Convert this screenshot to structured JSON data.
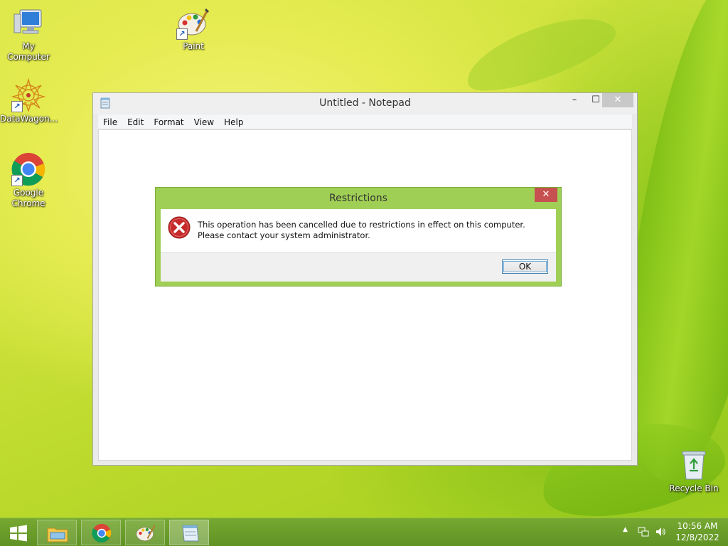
{
  "desktop": {
    "icons": [
      {
        "label": "My Computer",
        "icon": "computer-icon"
      },
      {
        "label": "Paint",
        "icon": "paint-palette-icon"
      },
      {
        "label": "DataWagon...",
        "icon": "datawagon-icon"
      },
      {
        "label": "Google Chrome",
        "icon": "chrome-icon"
      },
      {
        "label": "Recycle Bin",
        "icon": "recycle-bin-icon"
      }
    ]
  },
  "notepad": {
    "title": "Untitled - Notepad",
    "menu": [
      "File",
      "Edit",
      "Format",
      "View",
      "Help"
    ],
    "caption_buttons": {
      "minimize": "–",
      "maximize": "☐",
      "close": "✕"
    }
  },
  "dialog": {
    "title": "Restrictions",
    "message": "This operation has been cancelled due to restrictions in effect on this computer. Please contact your system administrator.",
    "ok_label": "OK",
    "close_glyph": "✕",
    "icon": "error-icon"
  },
  "taskbar": {
    "pinned": [
      "file-explorer-icon",
      "chrome-icon",
      "paint-palette-icon",
      "notepad-icon"
    ],
    "clock": {
      "time": "10:56 AM",
      "date": "12/8/2022"
    },
    "tray_chevron": "▲"
  },
  "colors": {
    "dialog_frame": "#9fcf55",
    "close_red": "#c75050",
    "taskbar": "#6a9d2a"
  }
}
